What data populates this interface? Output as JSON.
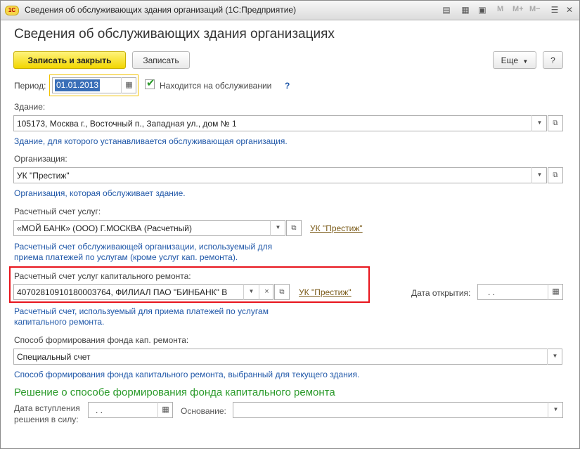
{
  "window": {
    "app_logo": "1С",
    "title": "Сведения об обслуживающих здания организаций (1С:Предприятие)",
    "m_labels": [
      "M",
      "M+",
      "M−"
    ]
  },
  "page": {
    "title": "Сведения об обслуживающих здания организациях"
  },
  "toolbar": {
    "save_close_label": "Записать и закрыть",
    "save_label": "Записать",
    "more_label": "Еще",
    "help_label": "?"
  },
  "period": {
    "label": "Период:",
    "value": "01.01.2013",
    "serviced_label": "Находится на обслуживании",
    "serviced_checked": true,
    "help": "?"
  },
  "building": {
    "label": "Здание:",
    "value": "105173, Москва г., Восточный п., Западная ул., дом № 1",
    "hint": "Здание, для которого устанавливается обслуживающая организация."
  },
  "organization": {
    "label": "Организация:",
    "value": "УК \"Престиж\"",
    "hint": "Организация, которая обслуживает здание."
  },
  "account": {
    "label": "Расчетный счет услуг:",
    "value": "«МОЙ БАНК» (ООО) Г.МОСКВА (Расчетный)",
    "link": "УК \"Престиж\"",
    "hint_line1": "Расчетный счет обслуживающей организации, используемый для",
    "hint_line2": "приема платежей по услугам (кроме услуг кап. ремонта)."
  },
  "capital_account": {
    "label": "Расчетный счет услуг капитального ремонта:",
    "value": "40702810910180003764, ФИЛИАЛ ПАО \"БИНБАНК\" В",
    "link": "УК \"Престиж\"",
    "open_date_label": "Дата открытия:",
    "open_date_value": " .  .",
    "hint_line1": "Расчетный счет, используемый для приема платежей по услугам",
    "hint_line2": "капитального ремонта."
  },
  "fund_method": {
    "label": "Способ формирования фонда кап. ремонта:",
    "value": "Специальный счет",
    "hint": "Способ формирования фонда капитального ремонта, выбранный для текущего здания."
  },
  "decision": {
    "title": "Решение о способе формирования фонда капитального ремонта",
    "effective_label_line1": "Дата вступления",
    "effective_label_line2": "решения в силу:",
    "effective_value": " .  .",
    "basis_label": "Основание:",
    "basis_value": ""
  }
}
